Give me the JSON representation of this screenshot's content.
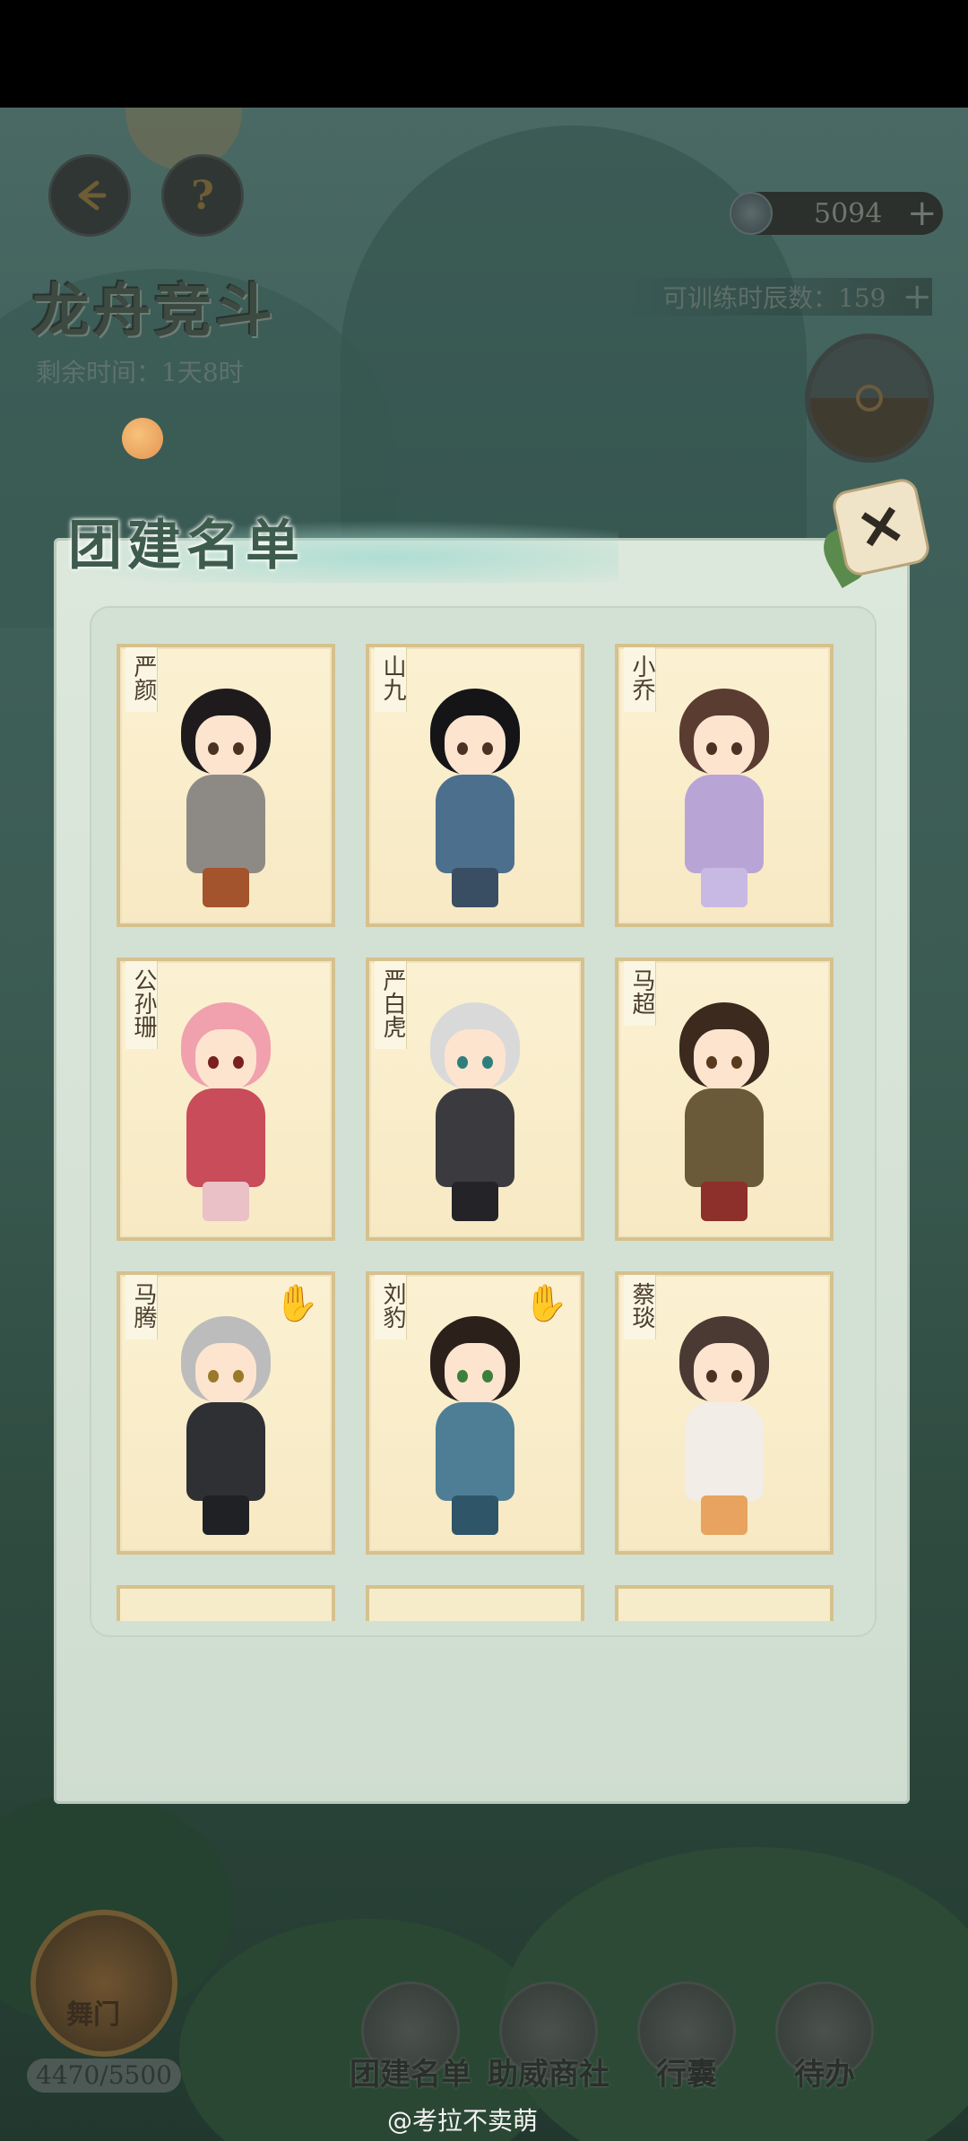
{
  "header": {
    "title": "龙舟竞斗",
    "remaining_time": "剩余时间：1天8时",
    "currency_value": "5094",
    "plus_symbol": "+",
    "training_hours": "可训练时辰数：159",
    "back_icon": "back-arrow-icon",
    "help_label": "?"
  },
  "panel": {
    "title": "团建名单",
    "close_label": "✕",
    "cards": [
      {
        "name": "严颜",
        "hair": "#1f1b1d",
        "body": "#8d8a86",
        "legs": "#a4542c",
        "eye": "#4a3323",
        "hand": false
      },
      {
        "name": "山九",
        "hair": "#151518",
        "body": "#4c6f8e",
        "legs": "#3a4e63",
        "eye": "#4a3323",
        "hand": false
      },
      {
        "name": "小乔",
        "hair": "#5b3c30",
        "body": "#b9a4d6",
        "legs": "#c8b9e4",
        "eye": "#4a3323",
        "hand": false
      },
      {
        "name": "公孙珊",
        "hair": "#f0a1ad",
        "body": "#c94c5a",
        "legs": "#e9c1c6",
        "eye": "#7a2020",
        "hand": false
      },
      {
        "name": "严白虎",
        "hair": "#d9d9d9",
        "body": "#3b3b3f",
        "legs": "#242428",
        "eye": "#2e7f7c",
        "hand": false
      },
      {
        "name": "马超",
        "hair": "#3b2a1d",
        "body": "#6b5a3a",
        "legs": "#8d2f2a",
        "eye": "#5a3a1d",
        "hand": false
      },
      {
        "name": "马腾",
        "hair": "#bcbcbc",
        "body": "#2f3033",
        "legs": "#202124",
        "eye": "#9a7a2a",
        "hand": true
      },
      {
        "name": "刘豹",
        "hair": "#2c201b",
        "body": "#4d7e95",
        "legs": "#2f5569",
        "eye": "#3c7f3b",
        "hand": true
      },
      {
        "name": "蔡琰",
        "hair": "#4a3a33",
        "body": "#f2ede6",
        "legs": "#e7a35f",
        "eye": "#4a3323",
        "hand": false
      }
    ],
    "hand_icon": "hand-icon"
  },
  "bottom_nav": {
    "dragon_label": "舞门",
    "stamina": "4470/5500",
    "items": [
      {
        "label": "团建名单",
        "icon": "roster-book-icon"
      },
      {
        "label": "助威商社",
        "icon": "shop-stall-icon"
      },
      {
        "label": "行囊",
        "icon": "bag-icon"
      },
      {
        "label": "待办",
        "icon": "scroll-todo-icon"
      }
    ]
  },
  "watermark": "@考拉不卖萌",
  "colors": {
    "panel_bg": "#dde8dc",
    "card_bg": "#fbf1d2",
    "card_border": "#d6c18d",
    "title_color": "#3e5c4e"
  }
}
